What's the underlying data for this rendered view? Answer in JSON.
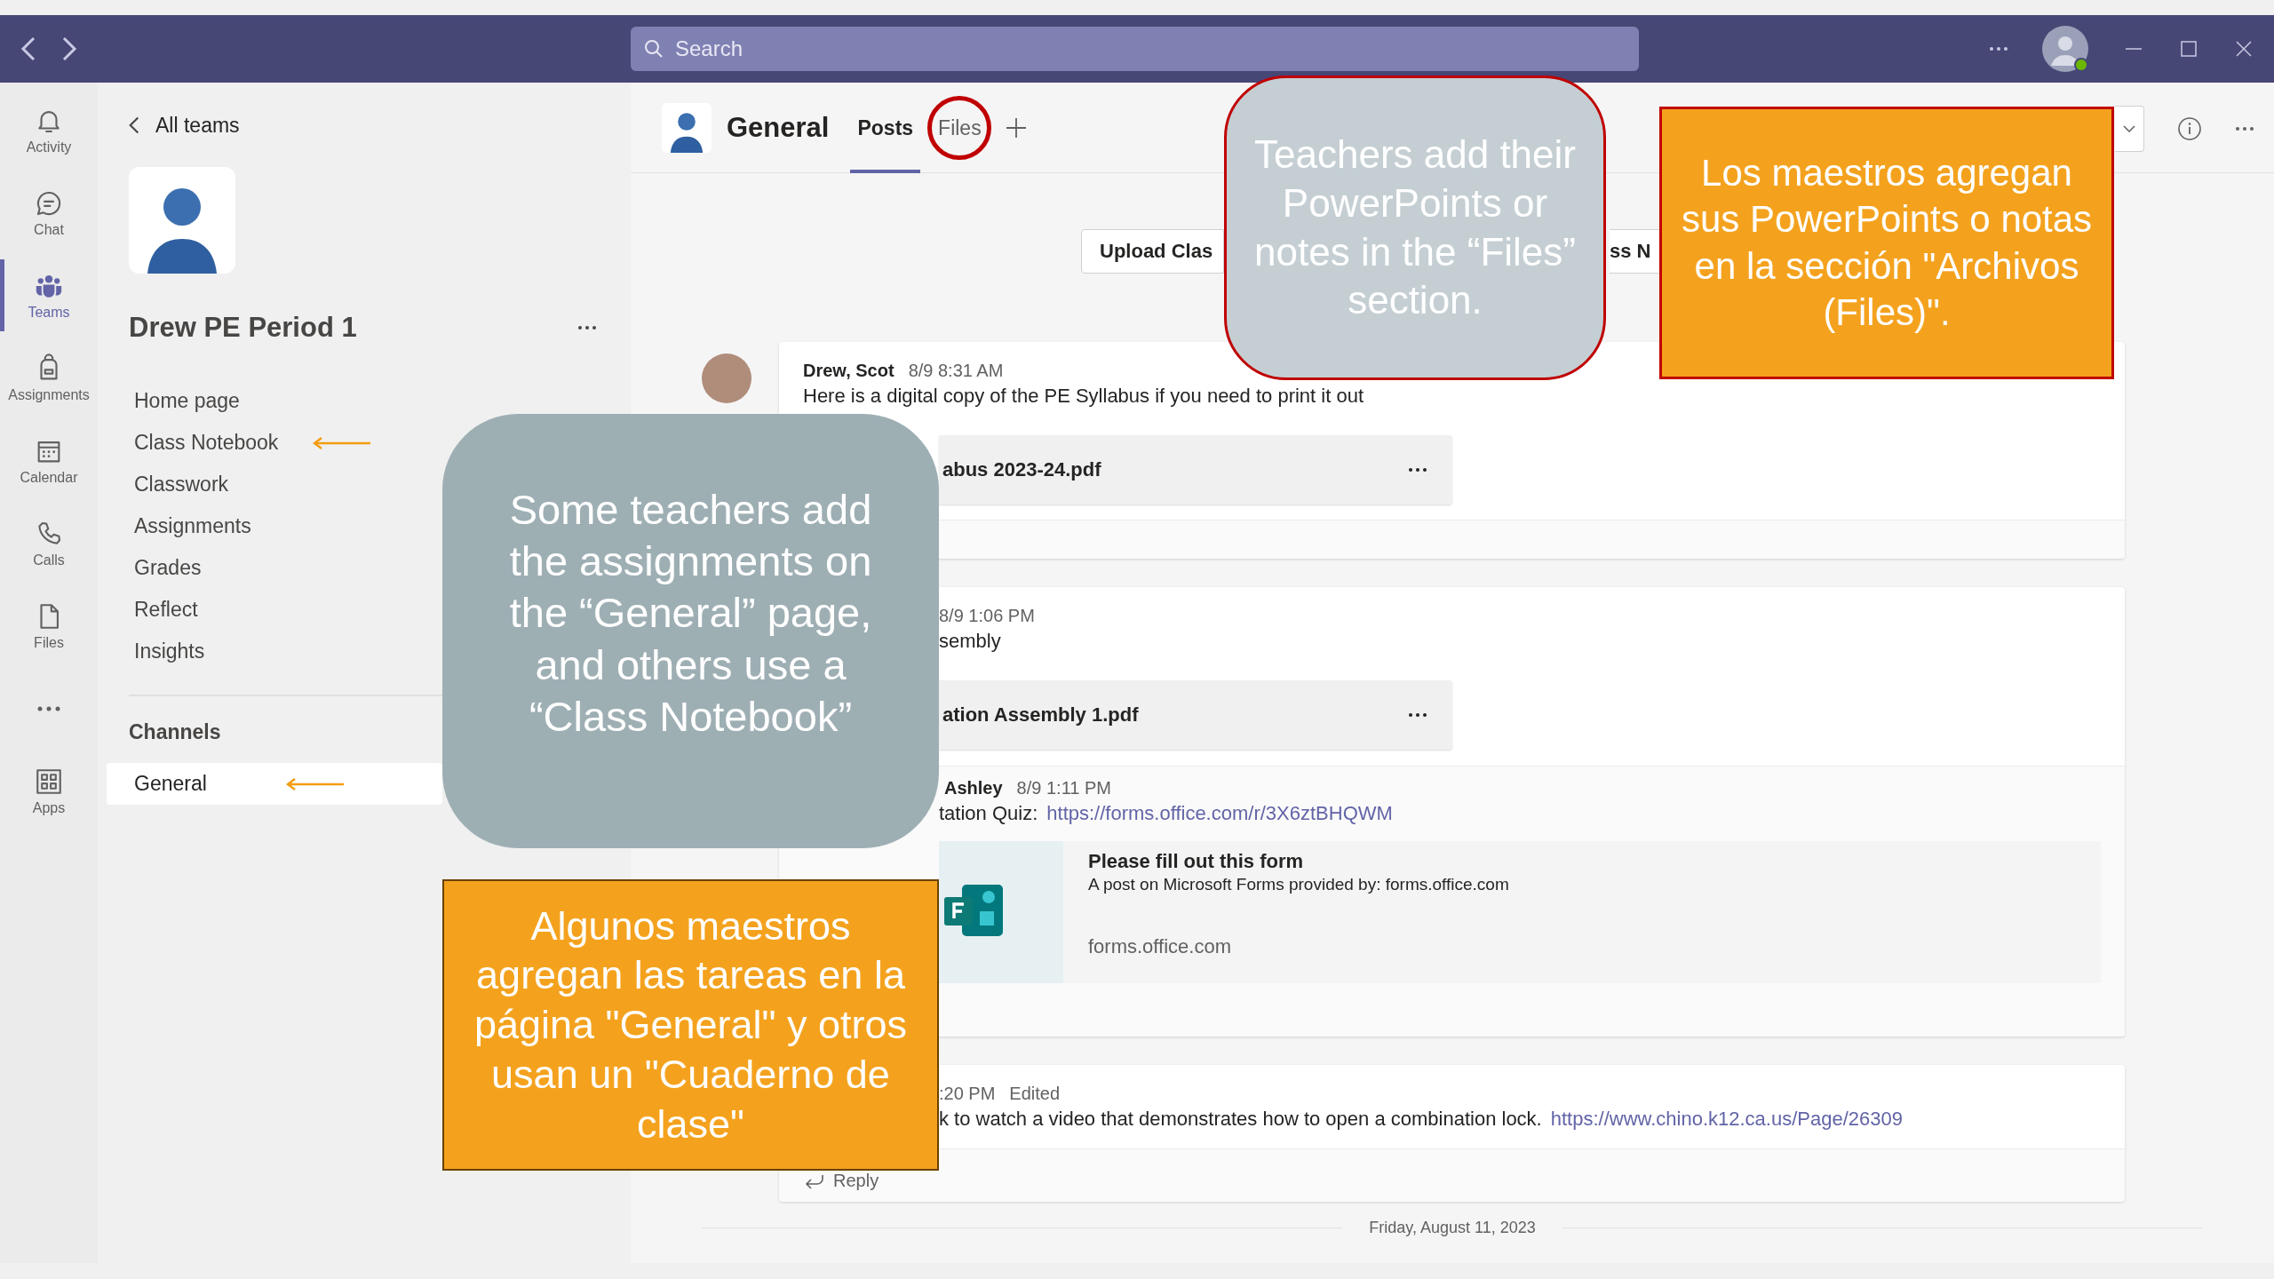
{
  "titlebar": {
    "search": {
      "placeholder": "Search"
    }
  },
  "rail": [
    {
      "label": "Activity",
      "selected": false
    },
    {
      "label": "Chat",
      "selected": false
    },
    {
      "label": "Teams",
      "selected": true
    },
    {
      "label": "Assignments",
      "selected": false
    },
    {
      "label": "Calendar",
      "selected": false
    },
    {
      "label": "Calls",
      "selected": false
    },
    {
      "label": "Files",
      "selected": false
    },
    {
      "label": "Apps",
      "selected": false
    }
  ],
  "team_panel": {
    "back_label": "All teams",
    "team_name": "Drew PE Period 1",
    "nav": [
      {
        "label": "Home page",
        "selected": false,
        "arrow": false
      },
      {
        "label": "Class Notebook",
        "selected": false,
        "arrow": true
      },
      {
        "label": "Classwork",
        "selected": false,
        "arrow": false
      },
      {
        "label": "Assignments",
        "selected": false,
        "arrow": false
      },
      {
        "label": "Grades",
        "selected": false,
        "arrow": false
      },
      {
        "label": "Reflect",
        "selected": false,
        "arrow": false
      },
      {
        "label": "Insights",
        "selected": false,
        "arrow": false
      }
    ],
    "channels_heading": "Channels",
    "channels": [
      {
        "label": "General",
        "selected": true,
        "arrow": true
      }
    ]
  },
  "channel": {
    "name": "General",
    "tabs": [
      {
        "label": "Posts",
        "selected": true,
        "circled": false
      },
      {
        "label": "Files",
        "selected": false,
        "circled": true
      }
    ]
  },
  "toolbar_buttons": [
    "Upload Clas",
    "ss N"
  ],
  "posts": [
    {
      "author": "Drew, Scot",
      "time": "8/9 8:31 AM",
      "text": "Here is a digital copy of the PE Syllabus if you need to print it out",
      "attachment": "abus 2023-24.pdf"
    },
    {
      "time": "8/9 1:06 PM",
      "text": "sembly",
      "attachment": "ation Assembly 1.pdf",
      "replies": [
        {
          "author": "Ashley",
          "time": "8/9 1:11 PM",
          "text": "tation Quiz:",
          "link": "https://forms.office.com/r/3X6ztBHQWM",
          "preview": {
            "title": "Please fill out this form",
            "description": "A post on Microsoft Forms provided by: forms.office.com",
            "domain": "forms.office.com"
          }
        }
      ]
    },
    {
      "time": ":20 PM",
      "edited": "Edited",
      "text": "k to watch a video that demonstrates how to open a combination lock.",
      "link": "https://www.chino.k12.ca.us/Page/26309",
      "reply_label": "Reply"
    }
  ],
  "date_divider": "Friday, August 11, 2023",
  "callouts": [
    {
      "kind": "rounded",
      "text": "Teachers add their PowerPoints or notes in the “Files” section."
    },
    {
      "kind": "box",
      "text": "Los maestros agregan sus PowerPoints o notas en la sección \"Archivos (Files)\"."
    },
    {
      "kind": "rounded",
      "text": "Some teachers add the assignments on the “General” page, and others use a “Class Notebook”"
    },
    {
      "kind": "box",
      "text": "Algunos maestros agregan las tareas en la página \"General\" y otros usan un \"Cuaderno de clase\""
    }
  ]
}
